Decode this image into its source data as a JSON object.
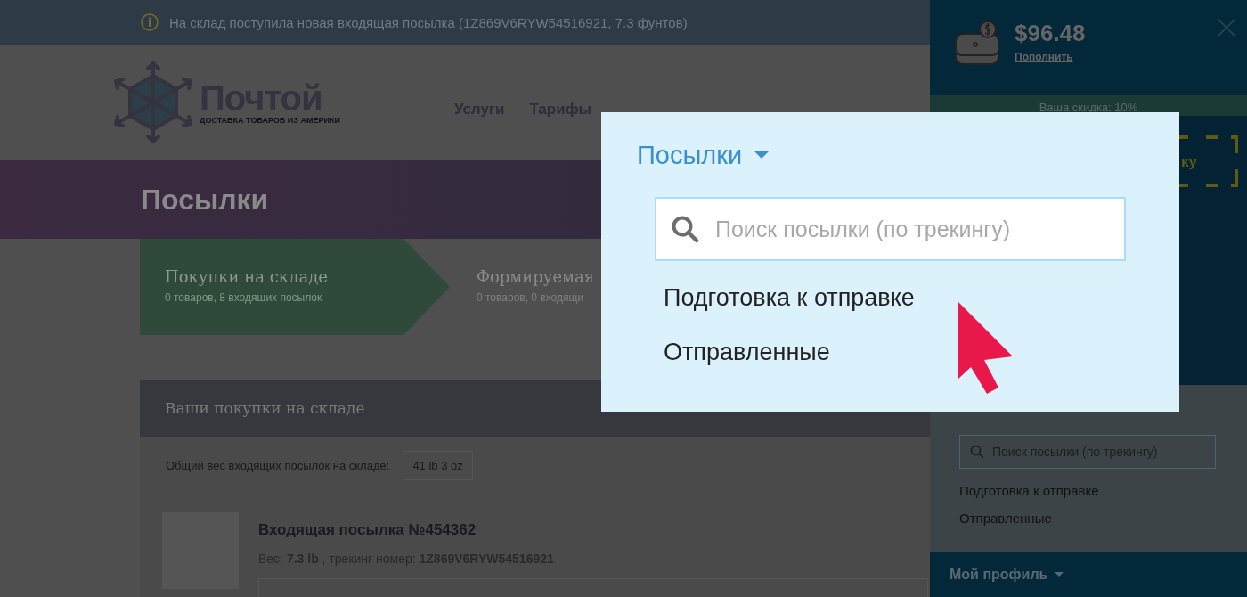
{
  "notice": {
    "text": "На склад поступила новая входящая посылка (1Z869V6RYW54516921, 7.3 фунтов)"
  },
  "logo": {
    "name": "Почтой",
    "tagline": "ДОСТАВКА ТОВАРОВ ИЗ АМЕРИКИ"
  },
  "nav": [
    {
      "label": "Услуги"
    },
    {
      "label": "Тарифы"
    }
  ],
  "page_title": "Посылки",
  "steps": [
    {
      "title": "Покупки на складе",
      "subtitle": "0 товаров, 8 входящих посылок",
      "selected": true
    },
    {
      "title": "Формируемая",
      "subtitle": "0 товаров, 0 входящи",
      "selected": false
    }
  ],
  "panel": {
    "title": "Ваши покупки на складе",
    "total_label": "Общий вес входящих посылок на складе:",
    "total_value": "41 lb 3 oz",
    "parcels": [
      {
        "title": "Входящая посылка №454362",
        "details": "Вес: **7.3 lb** , трекинг номер: **1Z869V6RYW54516921**"
      }
    ]
  },
  "sidebar": {
    "balance": "$96.48",
    "top_up": "Пополнить",
    "discount": "Ваша скидка: 10%",
    "promo_fragment": "ку",
    "search": {
      "placeholder": "Поиск посылки (по трекингу)"
    },
    "menu": [
      {
        "label": "Подготовка к отправке"
      },
      {
        "label": "Отправленные"
      }
    ],
    "profile": "Мой профиль"
  },
  "callout": {
    "title": "Посылки",
    "search": {
      "placeholder": "Поиск посылки (по трекингу)"
    },
    "menu": [
      {
        "label": "Подготовка к отправке"
      },
      {
        "label": "Отправленные"
      }
    ]
  }
}
